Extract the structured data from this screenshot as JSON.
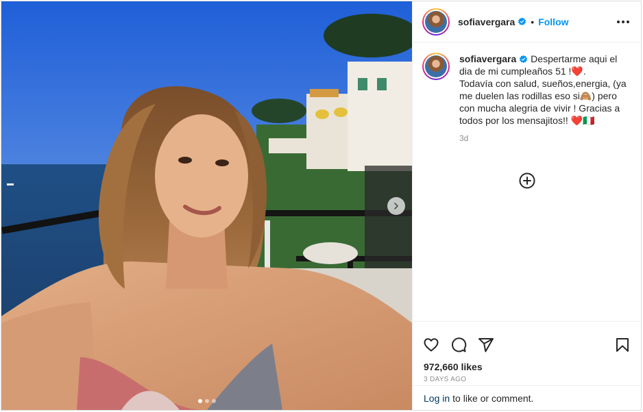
{
  "post": {
    "photo_alt": "",
    "slide_count": 3,
    "active_slide": 1
  },
  "header": {
    "username": "sofiavergara",
    "separator": "•",
    "follow_label": "Follow"
  },
  "caption": {
    "username": "sofiavergara",
    "text": "Despertarme aqui el dia de mi cumpleaños 51 !❤️.\nTodavía con salud, sueños,energia, (ya me duelen las rodillas eso si🙈) pero con mucha alegria de vivir ! Gracias a todos por los mensajitos!! ❤️🇮🇹",
    "time": "3d"
  },
  "actions": {
    "likes": "972,660 likes",
    "posted_ago": "3 DAYS AGO",
    "login_link": "Log in",
    "login_rest": "to like or comment."
  },
  "icons": {
    "verified": "verified-badge-icon",
    "more": "more-options-icon",
    "like": "heart-icon",
    "comment": "comment-icon",
    "share": "share-icon",
    "save": "bookmark-icon",
    "load_more": "add-circle-icon",
    "next": "chevron-right-icon"
  },
  "colors": {
    "accent": "#0095f6",
    "verified": "#0095f6",
    "link": "#00376b",
    "muted": "#8e8e8e",
    "border": "#dbdbdb"
  }
}
